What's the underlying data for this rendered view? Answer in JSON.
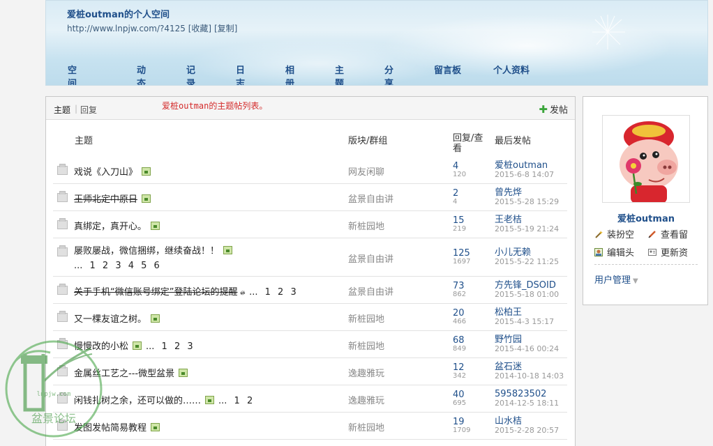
{
  "header": {
    "title": "爱桩outman的个人空间",
    "url": "http://www.lnpjw.com/?4125",
    "fav_label": "[收藏]",
    "copy_label": "[复制]",
    "nav": [
      "空间首页",
      "动态",
      "记录",
      "日志",
      "相册",
      "主题",
      "分享",
      "留言板",
      "个人资料"
    ]
  },
  "list": {
    "tab_topics": "主题",
    "tab_replies": "回复",
    "notice": "爱桩outman的主题帖列表。",
    "post_button": "发帖",
    "columns": {
      "topic": "主题",
      "forum": "版块/群组",
      "replies_views_1": "回复/查",
      "replies_views_2": "看",
      "last_post": "最后发帖"
    },
    "rows": [
      {
        "title": "戏说《入刀山》",
        "strike": false,
        "has_image": true,
        "pages": "",
        "forum": "网友闲聊",
        "replies": "4",
        "views": "120",
        "last_user": "爱桩outman",
        "last_time": "2015-6-8 14:07"
      },
      {
        "title": "王师北定中原日",
        "strike": true,
        "has_image": true,
        "pages": "",
        "forum": "盆景自由讲",
        "replies": "2",
        "views": "4",
        "last_user": "曾先烨",
        "last_time": "2015-5-28 15:29"
      },
      {
        "title": "真绑定，真开心。",
        "strike": false,
        "has_image": true,
        "pages": "",
        "forum": "新桩园地",
        "replies": "15",
        "views": "219",
        "last_user": "王老桔",
        "last_time": "2015-5-19 21:24"
      },
      {
        "title": "屡败屡战，微信捆绑，继续奋战！！",
        "strike": false,
        "has_image": true,
        "pages": "... 1 2 3 4 5 6",
        "forum": "盆景自由讲",
        "replies": "125",
        "views": "1697",
        "last_user": "小儿无赖",
        "last_time": "2015-5-22 11:25"
      },
      {
        "title": "关于手机“微信账号绑定”登陆论坛的提醒",
        "strike": true,
        "has_image": false,
        "pages": "... 1 2 3",
        "forum": "盆景自由讲",
        "replies": "73",
        "views": "862",
        "last_user": "方先锋_DSOID",
        "last_time": "2015-5-18 01:00"
      },
      {
        "title": "又一棵友谊之树。",
        "strike": false,
        "has_image": true,
        "pages": "",
        "forum": "新桩园地",
        "replies": "20",
        "views": "466",
        "last_user": "松柏王",
        "last_time": "2015-4-3 15:17"
      },
      {
        "title": "慢慢改的小松",
        "strike": false,
        "has_image": true,
        "pages": "... 1 2 3",
        "forum": "新桩园地",
        "replies": "68",
        "views": "849",
        "last_user": "野竹园",
        "last_time": "2015-4-16 00:24"
      },
      {
        "title": "金属丝工艺之---微型盆景",
        "strike": false,
        "has_image": true,
        "pages": "",
        "forum": "逸趣雅玩",
        "replies": "12",
        "views": "342",
        "last_user": "盆石迷",
        "last_time": "2014-10-18 14:03"
      },
      {
        "title": "闲钱扎树之余，还可以做的……",
        "strike": false,
        "has_image": true,
        "pages": "... 1 2",
        "forum": "逸趣雅玩",
        "replies": "40",
        "views": "695",
        "last_user": "595823502",
        "last_time": "2014-12-5 18:11"
      },
      {
        "title": "发图发帖简易教程",
        "strike": false,
        "has_image": true,
        "pages": "",
        "forum": "新桩园地",
        "replies": "19",
        "views": "1709",
        "last_user": "山水桔",
        "last_time": "2015-2-28 20:57"
      }
    ]
  },
  "profile": {
    "username": "爱桩outman",
    "actions": [
      "装扮空",
      "查看留",
      "编辑头",
      "更新资"
    ],
    "user_management": "用户管理"
  },
  "watermark": {
    "text": "盆景论坛",
    "url_text": "lnpjw.com"
  },
  "colors": {
    "link": "#1f4f8a",
    "notice": "#d42b2b",
    "accent_green": "#3aa53a"
  }
}
